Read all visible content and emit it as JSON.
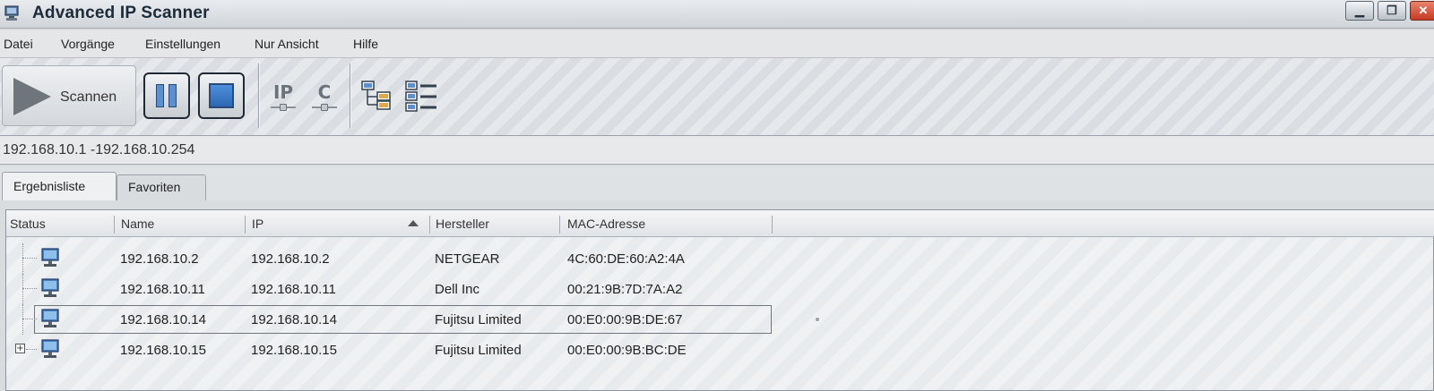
{
  "window": {
    "title": "Advanced IP Scanner",
    "controls": {
      "minimize_icon": "minimize-icon",
      "maximize_icon": "maximize-icon",
      "close_icon": "close-icon"
    }
  },
  "menu": {
    "items": [
      {
        "label": "Datei"
      },
      {
        "label": "Vorgänge"
      },
      {
        "label": "Einstellungen"
      },
      {
        "label": "Nur Ansicht"
      },
      {
        "label": "Hilfe"
      }
    ]
  },
  "toolbar": {
    "scan_label": "Scannen",
    "scan_icon": "play-icon",
    "pause_icon": "pause-icon",
    "stop_icon": "stop-icon",
    "ip_icon_text": "IP",
    "c_icon_text": "C",
    "tree_view_icon": "tree-view-icon",
    "list_view_icon": "list-view-icon"
  },
  "range": {
    "value": "192.168.10.1 -192.168.10.254"
  },
  "tabs": [
    {
      "label": "Ergebnisliste",
      "active": true
    },
    {
      "label": "Favoriten",
      "active": false
    }
  ],
  "table": {
    "columns": [
      "Status",
      "Name",
      "IP",
      "Hersteller",
      "MAC-Adresse"
    ],
    "sorted_column": "IP",
    "rows": [
      {
        "name": "192.168.10.2",
        "ip": "192.168.10.2",
        "vendor": "NETGEAR",
        "mac": "4C:60:DE:60:A2:4A"
      },
      {
        "name": "192.168.10.11",
        "ip": "192.168.10.11",
        "vendor": "Dell Inc",
        "mac": "00:21:9B:7D:7A:A2"
      },
      {
        "name": "192.168.10.14",
        "ip": "192.168.10.14",
        "vendor": "Fujitsu Limited",
        "mac": "00:E0:00:9B:DE:67",
        "selected": true
      },
      {
        "name": "192.168.10.15",
        "ip": "192.168.10.15",
        "vendor": "Fujitsu Limited",
        "mac": "00:E0:00:9B:BC:DE",
        "expandable": true
      }
    ]
  },
  "colors": {
    "accent_blue": "#3a78c9",
    "dark_border": "#1f2a36",
    "close_red": "#c63a22"
  }
}
